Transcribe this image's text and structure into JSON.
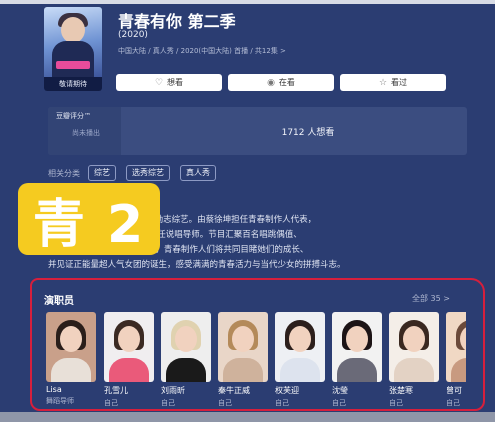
{
  "show": {
    "title": "青春有你 第二季",
    "year": "(2020)",
    "meta": "中国大陆 / 真人秀 / 2020(中国大陆) 首播 / 共12集 >",
    "poster_caption": "敬请期待"
  },
  "actions": [
    {
      "label": "想看",
      "icon": "heart-icon"
    },
    {
      "label": "在看",
      "icon": "play-icon"
    },
    {
      "label": "看过",
      "icon": "star-icon"
    }
  ],
  "rating": {
    "label": "豆瓣评分™",
    "value": "尚未播出",
    "want_count": "1712 人想看"
  },
  "related": {
    "label": "相关分类",
    "tags": [
      "综艺",
      "选秀综艺",
      "真人秀"
    ]
  },
  "summary_lines": [
    "2020年第一季度推出的青年励志综艺。由蔡徐坤担任青春制作人代表，",
    "Ella担任音乐导师，JONY J担任说唱导师。节目汇聚百名唱跳偶值、",
    "为期4个月的训练和舞台竞演，青春制作人们将共同目睹她们的成长、",
    "并见证正能量超人气女团的诞生，感受满满的青春活力与当代少女的拼搏斗志。"
  ],
  "overlay_text": "青 2",
  "cast": {
    "title": "演职员",
    "all_label": "全部 35 >",
    "members": [
      {
        "name": "Lisa",
        "role": "舞蹈导师",
        "hair": "#2a1e1a",
        "bg": "#c9a08a",
        "clothes": "#e8e0d8"
      },
      {
        "name": "孔雪儿",
        "role": "自己",
        "hair": "#3b2a23",
        "bg": "#f0eef0",
        "clothes": "#ea5a7a"
      },
      {
        "name": "刘雨昕",
        "role": "自己",
        "hair": "#e0d2b0",
        "bg": "#eeeeee",
        "clothes": "#1a1a1a"
      },
      {
        "name": "秦牛正威",
        "role": "自己",
        "hair": "#b48a5a",
        "bg": "#e9d6c8",
        "clothes": "#cfb29c"
      },
      {
        "name": "权芙迎",
        "role": "自己",
        "hair": "#2c1f1c",
        "bg": "#eef0f4",
        "clothes": "#dde3ee"
      },
      {
        "name": "沈瑩",
        "role": "自己",
        "hair": "#1c1416",
        "bg": "#f2f2f2",
        "clothes": "#6a6a78"
      },
      {
        "name": "张楚寒",
        "role": "自己",
        "hair": "#3a2820",
        "bg": "#f4eee8",
        "clothes": "#e3d2c4"
      },
      {
        "name": "曾可",
        "role": "自己",
        "hair": "#6b4a3a",
        "bg": "#f0d8c4",
        "clothes": "#c89a80"
      }
    ]
  }
}
